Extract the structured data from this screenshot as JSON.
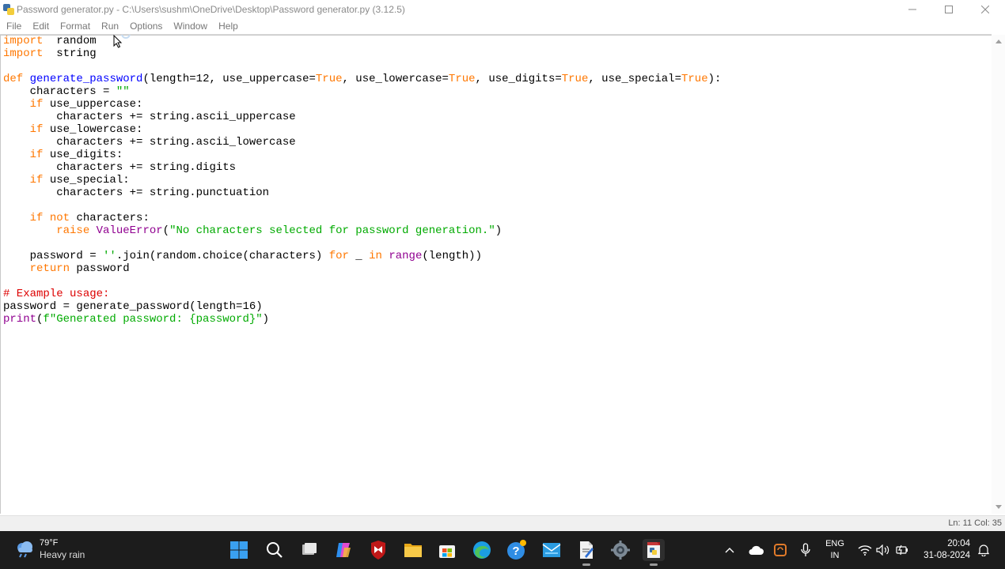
{
  "window": {
    "title": "Password generator.py - C:\\Users\\sushm\\OneDrive\\Desktop\\Password generator.py (3.12.5)",
    "controls": {
      "minimize_icon": "minimize-icon",
      "maximize_icon": "maximize-icon",
      "close_icon": "close-icon"
    }
  },
  "menu": [
    "File",
    "Edit",
    "Format",
    "Run",
    "Options",
    "Window",
    "Help"
  ],
  "colors": {
    "keyword": "#ff7700",
    "definition": "#0000ff",
    "string": "#00aa00",
    "comment": "#dd0000",
    "builtin": "#900090"
  },
  "code": {
    "lines": [
      [
        [
          "kw",
          "import"
        ],
        [
          "",
          "  random"
        ]
      ],
      [
        [
          "kw",
          "import"
        ],
        [
          "",
          "  string"
        ]
      ],
      [],
      [
        [
          "kw",
          "def"
        ],
        [
          "",
          " "
        ],
        [
          "def",
          "generate_password"
        ],
        [
          "",
          "(length=12, use_uppercase="
        ],
        [
          "kw",
          "True"
        ],
        [
          "",
          ", use_lowercase="
        ],
        [
          "kw",
          "True"
        ],
        [
          "",
          ", use_digits="
        ],
        [
          "kw",
          "True"
        ],
        [
          "",
          ", use_special="
        ],
        [
          "kw",
          "True"
        ],
        [
          "",
          "):"
        ]
      ],
      [
        [
          "",
          "    characters = "
        ],
        [
          "str",
          "\"\""
        ]
      ],
      [
        [
          "",
          "    "
        ],
        [
          "kw",
          "if"
        ],
        [
          "",
          " use_uppercase:"
        ]
      ],
      [
        [
          "",
          "        characters += string.ascii_uppercase"
        ]
      ],
      [
        [
          "",
          "    "
        ],
        [
          "kw",
          "if"
        ],
        [
          "",
          " use_lowercase:"
        ]
      ],
      [
        [
          "",
          "        characters += string.ascii_lowercase"
        ]
      ],
      [
        [
          "",
          "    "
        ],
        [
          "kw",
          "if"
        ],
        [
          "",
          " use_digits:"
        ]
      ],
      [
        [
          "",
          "        characters += string.digits"
        ]
      ],
      [
        [
          "",
          "    "
        ],
        [
          "kw",
          "if"
        ],
        [
          "",
          " use_special:"
        ]
      ],
      [
        [
          "",
          "        characters += string.punctuation"
        ]
      ],
      [],
      [
        [
          "",
          "    "
        ],
        [
          "kw",
          "if"
        ],
        [
          "",
          " "
        ],
        [
          "kw",
          "not"
        ],
        [
          "",
          " characters:"
        ]
      ],
      [
        [
          "",
          "        "
        ],
        [
          "kw",
          "raise"
        ],
        [
          "",
          " "
        ],
        [
          "bi",
          "ValueError"
        ],
        [
          "",
          "("
        ],
        [
          "str",
          "\"No characters selected for password generation.\""
        ],
        [
          "",
          ")"
        ]
      ],
      [],
      [
        [
          "",
          "    password = "
        ],
        [
          "str",
          "''"
        ],
        [
          "",
          ".join(random.choice(characters) "
        ],
        [
          "kw",
          "for"
        ],
        [
          "",
          " _ "
        ],
        [
          "kw",
          "in"
        ],
        [
          "",
          " "
        ],
        [
          "bi",
          "range"
        ],
        [
          "",
          "(length))"
        ]
      ],
      [
        [
          "",
          "    "
        ],
        [
          "kw",
          "return"
        ],
        [
          "",
          " password"
        ]
      ],
      [],
      [
        [
          "cmt",
          "# Example usage:"
        ]
      ],
      [
        [
          "",
          "password = generate_password(length=16)"
        ]
      ],
      [
        [
          "bi",
          "print"
        ],
        [
          "",
          "("
        ],
        [
          "str",
          "f\"Generated password: {password}\""
        ],
        [
          "",
          ")"
        ]
      ]
    ]
  },
  "status": {
    "position": "Ln: 11   Col: 35"
  },
  "taskbar": {
    "weather": {
      "temp": "79°F",
      "condition": "Heavy rain",
      "icon": "weather-rain-icon"
    },
    "apps": [
      "windows-start-icon",
      "search-icon",
      "task-view-icon",
      "copilot-icon",
      "mcafee-icon",
      "file-explorer-icon",
      "microsoft-store-icon",
      "edge-icon",
      "help-icon",
      "mail-icon",
      "notepad-icon",
      "settings-icon",
      "python-idle-icon"
    ],
    "tray": {
      "language": "ENG",
      "region": "IN",
      "time": "20:04",
      "date": "31-08-2024"
    }
  }
}
